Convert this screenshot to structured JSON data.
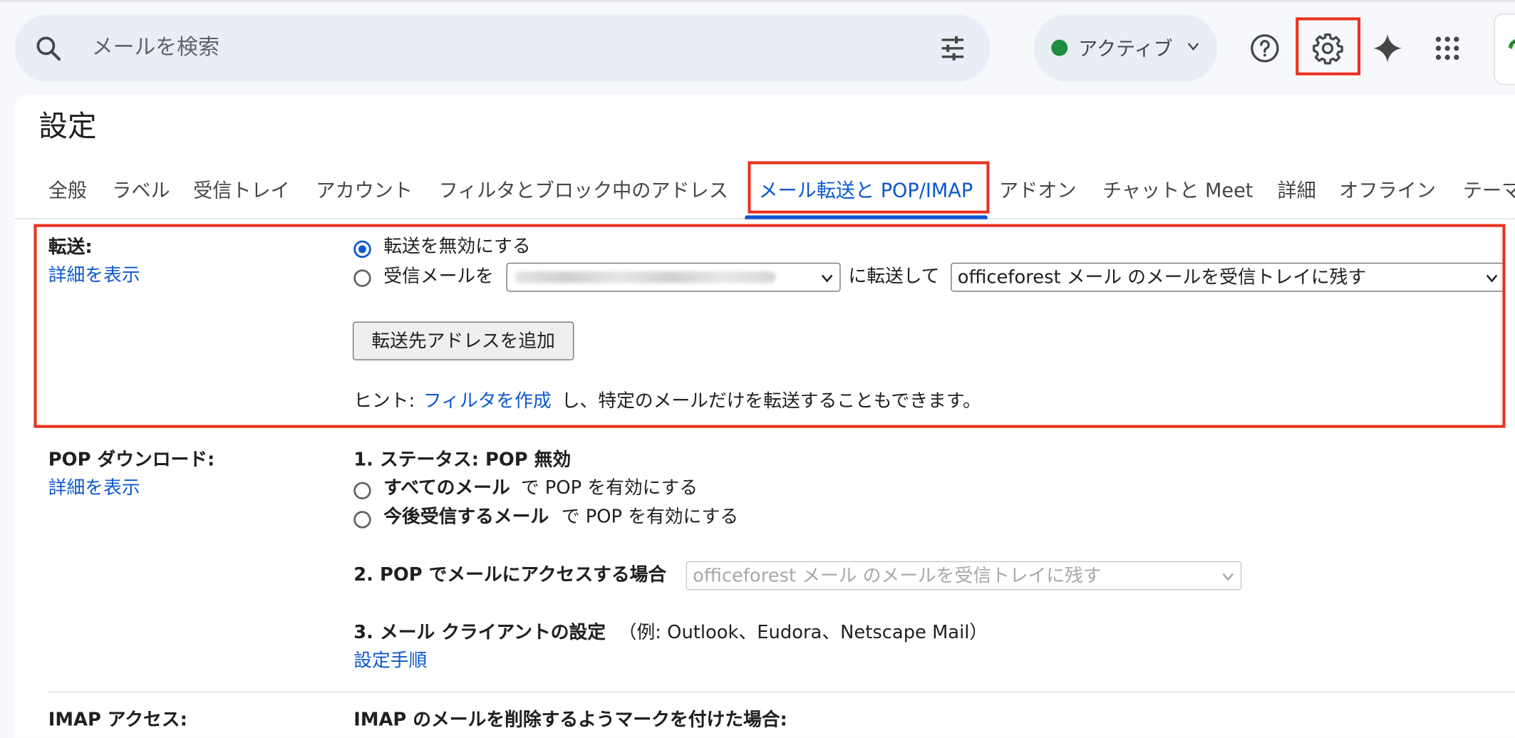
{
  "search": {
    "placeholder": "メールを検索"
  },
  "status": {
    "label": "アクティブ",
    "dot_color": "#1e8e3e"
  },
  "header_icons": [
    "help-icon",
    "gear-icon",
    "gemini-icon",
    "apps-icon"
  ],
  "page_title": "設定",
  "tabs": [
    "全般",
    "ラベル",
    "受信トレイ",
    "アカウント",
    "フィルタとブロック中のアドレス",
    "メール転送と POP/IMAP",
    "アドオン",
    "チャットと Meet",
    "詳細",
    "オフライン",
    "テーマ"
  ],
  "active_tab": "メール転送と POP/IMAP",
  "forwarding": {
    "label": "転送:",
    "details_link": "詳細を表示",
    "option_disable": "転送を無効にする",
    "option_forward_prefix": "受信メールを",
    "option_forward_middle": "に転送して",
    "keep_select_value": "officeforest メール のメールを受信トレイに残す",
    "add_button": "転送先アドレスを追加",
    "hint_prefix": "ヒント: ",
    "hint_link": "フィルタを作成",
    "hint_suffix": "し、特定のメールだけを転送することもできます。"
  },
  "pop": {
    "label": "POP ダウンロード:",
    "details_link": "詳細を表示",
    "status_heading": "1. ステータス: POP 無効",
    "option_all_bold": "すべてのメール",
    "option_all_rest": "で POP を有効にする",
    "option_new_bold": "今後受信するメール",
    "option_new_rest": "で POP を有効にする",
    "access_label": "2. POP でメールにアクセスする場合",
    "access_select_value": "officeforest メール のメールを受信トレイに残す",
    "client_bold": "3. メール クライアントの設定",
    "client_rest": "（例: Outlook、Eudora、Netscape Mail）",
    "setup_link": "設定手順"
  },
  "imap": {
    "label": "IMAP アクセス:",
    "delete_heading": "IMAP のメールを削除するようマークを付けた場合:"
  },
  "accent_color": "#0b57d0",
  "highlight_color": "#e8321f"
}
